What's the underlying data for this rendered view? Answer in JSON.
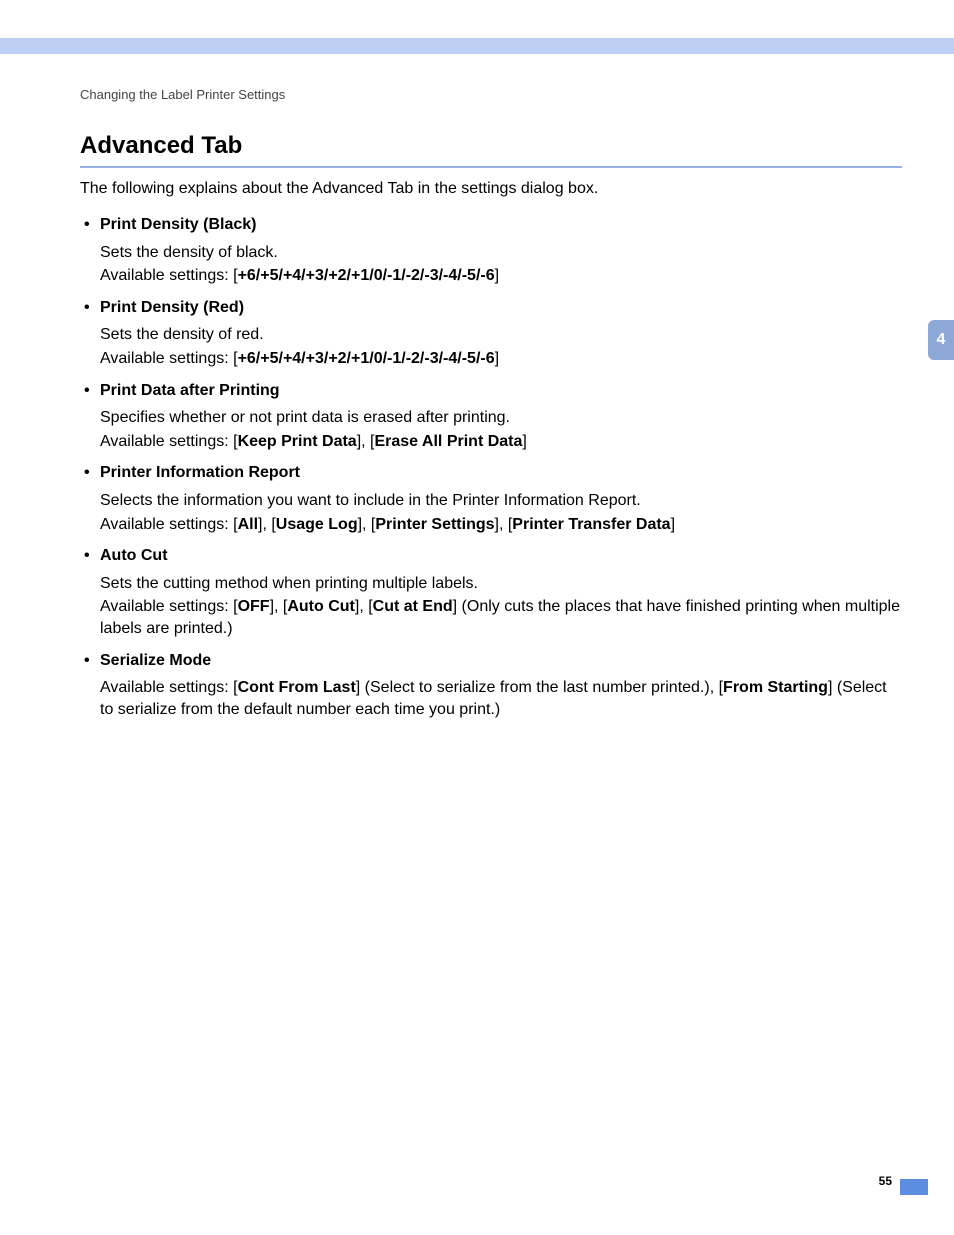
{
  "header": {
    "running": "Changing the Label Printer Settings"
  },
  "title": "Advanced Tab",
  "intro": "The following explains about the Advanced Tab in the settings dialog box.",
  "chapter": "4",
  "pageNumber": "55",
  "items": [
    {
      "label": "Print Density (Black)",
      "lines": [
        {
          "segments": [
            {
              "text": "Sets the density of black."
            }
          ]
        },
        {
          "segments": [
            {
              "text": "Available settings: ["
            },
            {
              "text": "+6/+5/+4/+3/+2/+1/0/-1/-2/-3/-4/-5/-6",
              "bold": true
            },
            {
              "text": "]"
            }
          ]
        }
      ]
    },
    {
      "label": "Print Density (Red)",
      "lines": [
        {
          "segments": [
            {
              "text": "Sets the density of red."
            }
          ]
        },
        {
          "segments": [
            {
              "text": "Available settings: ["
            },
            {
              "text": "+6/+5/+4/+3/+2/+1/0/-1/-2/-3/-4/-5/-6",
              "bold": true
            },
            {
              "text": "]"
            }
          ]
        }
      ]
    },
    {
      "label": "Print Data after Printing",
      "lines": [
        {
          "segments": [
            {
              "text": "Specifies whether or not print data is erased after printing."
            }
          ]
        },
        {
          "segments": [
            {
              "text": "Available settings: ["
            },
            {
              "text": "Keep Print Data",
              "bold": true
            },
            {
              "text": "], ["
            },
            {
              "text": "Erase All Print Data",
              "bold": true
            },
            {
              "text": "]"
            }
          ]
        }
      ]
    },
    {
      "label": "Printer Information Report",
      "lines": [
        {
          "segments": [
            {
              "text": "Selects the information you want to include in the Printer Information Report."
            }
          ]
        },
        {
          "segments": [
            {
              "text": "Available settings: ["
            },
            {
              "text": "All",
              "bold": true
            },
            {
              "text": "], ["
            },
            {
              "text": "Usage Log",
              "bold": true
            },
            {
              "text": "], ["
            },
            {
              "text": "Printer Settings",
              "bold": true
            },
            {
              "text": "], ["
            },
            {
              "text": "Printer Transfer Data",
              "bold": true
            },
            {
              "text": "]"
            }
          ]
        }
      ]
    },
    {
      "label": "Auto Cut",
      "lines": [
        {
          "segments": [
            {
              "text": "Sets the cutting method when printing multiple labels."
            }
          ]
        },
        {
          "segments": [
            {
              "text": "Available settings: ["
            },
            {
              "text": "OFF",
              "bold": true
            },
            {
              "text": "], ["
            },
            {
              "text": "Auto Cut",
              "bold": true
            },
            {
              "text": "], ["
            },
            {
              "text": "Cut at End",
              "bold": true
            },
            {
              "text": "] (Only cuts the places that have finished printing when multiple labels are printed.)"
            }
          ]
        }
      ]
    },
    {
      "label": "Serialize Mode",
      "lines": [
        {
          "segments": [
            {
              "text": "Available settings: ["
            },
            {
              "text": "Cont From Last",
              "bold": true
            },
            {
              "text": "] (Select to serialize from the last number printed.), ["
            },
            {
              "text": "From Starting",
              "bold": true
            },
            {
              "text": "] (Select to serialize from the default number each time you print.)"
            }
          ]
        }
      ]
    }
  ]
}
